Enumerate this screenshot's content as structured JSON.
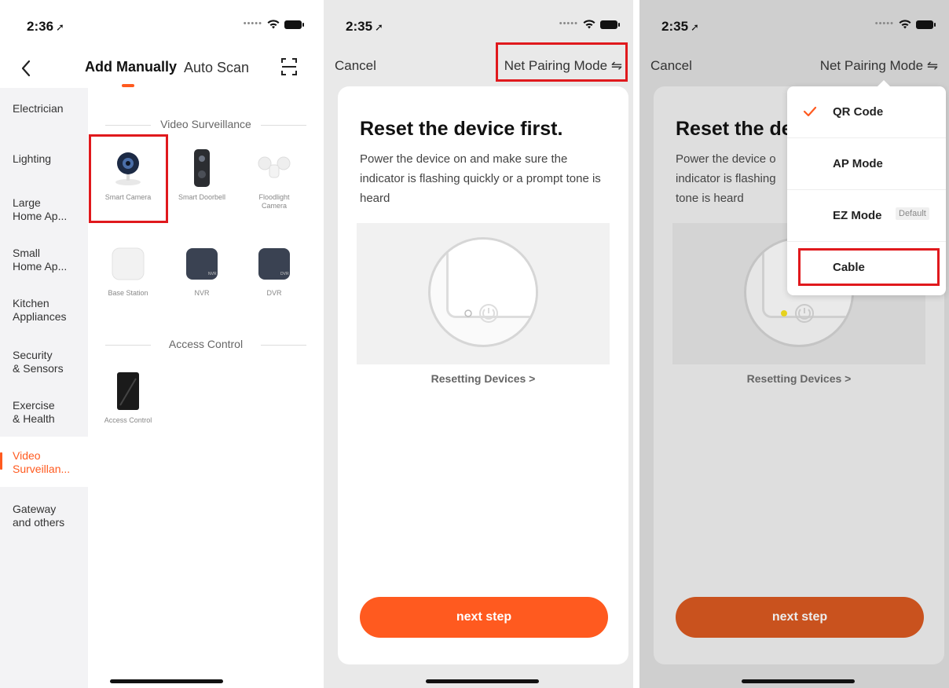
{
  "screen1": {
    "time": "2:36",
    "tabs": {
      "manual": "Add Manually",
      "auto": "Auto Scan"
    },
    "categories": [
      "Electrician",
      "Lighting",
      "Large\nHome Ap...",
      "Small\nHome Ap...",
      "Kitchen\nAppliances",
      "Security\n& Sensors",
      "Exercise\n& Health",
      "Video\nSurveillan...",
      "Gateway\nand others"
    ],
    "sections": {
      "video": "Video Surveillance",
      "access": "Access Control"
    },
    "devices": {
      "smart_camera": "Smart Camera",
      "smart_doorbell": "Smart Doorbell",
      "floodlight_camera": "Floodlight\nCamera",
      "base_station": "Base Station",
      "nvr": "NVR",
      "dvr": "DVR",
      "access_control": "Access Control"
    },
    "badges": {
      "nvr": "NVR",
      "dvr": "DVR"
    }
  },
  "screen2": {
    "time": "2:35",
    "cancel": "Cancel",
    "pairing_mode": "Net Pairing Mode ⇋",
    "title": "Reset the device first.",
    "description": "Power the device on and make sure the indicator is flashing quickly or a prompt tone is heard",
    "reset_link": "Resetting Devices >",
    "next_button": "next step"
  },
  "screen3": {
    "time": "2:35",
    "cancel": "Cancel",
    "pairing_mode": "Net Pairing Mode ⇋",
    "title": "Reset the de",
    "description": "Power the device o\nindicator is flashing\ntone is heard",
    "reset_link": "Resetting Devices >",
    "next_button": "next step",
    "menu": {
      "qr": "QR Code",
      "ap": "AP Mode",
      "ez": "EZ Mode",
      "ez_badge": "Default",
      "cable": "Cable"
    }
  },
  "colors": {
    "accent": "#ff5a1f",
    "highlight_box": "#e0191d"
  },
  "icons": [
    "back-chevron-icon",
    "scan-qr-icon",
    "wifi-icon",
    "battery-icon",
    "location-arrow-icon",
    "checkmark-icon",
    "swap-arrows-icon"
  ]
}
